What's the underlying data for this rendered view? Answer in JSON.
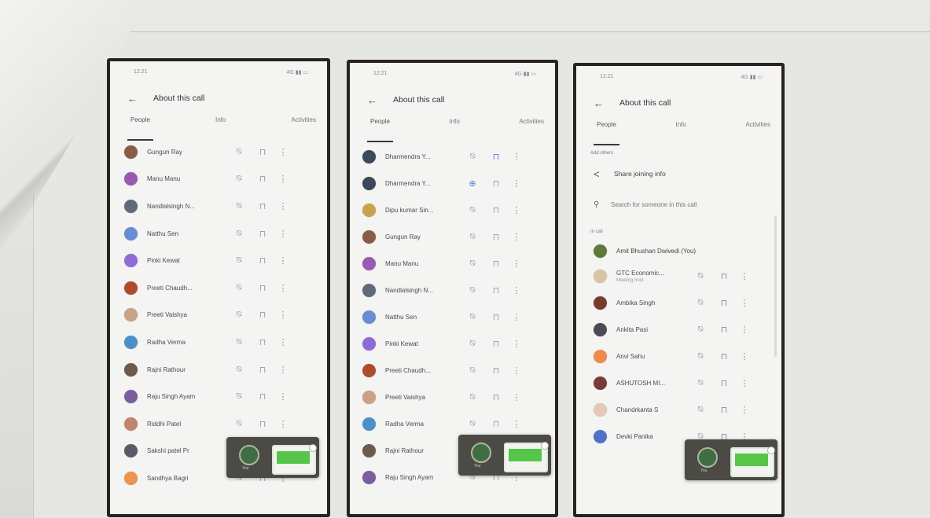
{
  "screen": {
    "title": "About this call",
    "tabs": [
      "People",
      "Info",
      "Activities"
    ],
    "status_time": "12:21",
    "status_right": "4G ▮▮ ▭"
  },
  "icons": {
    "back": "arrow-left-icon",
    "mic_off": "mic-off-icon",
    "pin": "pin-icon",
    "more": "more-vert-icon",
    "share": "share-icon",
    "search": "search-icon",
    "add_person": "add-person-icon"
  },
  "phone1": {
    "people": [
      {
        "name": "Gungun Ray",
        "color": "#8a5b48"
      },
      {
        "name": "Manu Manu",
        "color": "#9b59b6"
      },
      {
        "name": "Nandlalsingh N...",
        "color": "#616a7a"
      },
      {
        "name": "Natthu Sen",
        "color": "#6b8bd6"
      },
      {
        "name": "Pinki Kewat",
        "color": "#8e6bd6"
      },
      {
        "name": "Preeti Chaudh...",
        "color": "#b04a2c"
      },
      {
        "name": "Preeti Vaishya",
        "color": "#c9a187"
      },
      {
        "name": "Radha Verma",
        "color": "#4a90c8"
      },
      {
        "name": "Rajni Rathour",
        "color": "#6d5a4c"
      },
      {
        "name": "Raju Singh Ayam",
        "color": "#7b5ea0"
      },
      {
        "name": "Riddhi Patel",
        "color": "#c0846c"
      },
      {
        "name": "Sakshi patel Pr",
        "color": "#5a5a66"
      },
      {
        "name": "Sandhya Bagri",
        "color": "#f0934e"
      }
    ]
  },
  "phone2": {
    "people": [
      {
        "name": "Dharmendra Y...",
        "color": "#3a4a5a",
        "blue": false,
        "pin_blue": true
      },
      {
        "name": "Dharmendra Y...",
        "color": "#3a4a5a",
        "blue": true,
        "pin_blue": false
      },
      {
        "name": "Dipu kumar Sin...",
        "color": "#c8a34a",
        "blue": false,
        "pin_blue": false
      },
      {
        "name": "Gungun Ray",
        "color": "#8a5b48",
        "blue": false,
        "pin_blue": false
      },
      {
        "name": "Manu Manu",
        "color": "#9b59b6",
        "blue": false,
        "pin_blue": false
      },
      {
        "name": "Nandlalsingh N...",
        "color": "#616a7a",
        "blue": false,
        "pin_blue": false
      },
      {
        "name": "Natthu Sen",
        "color": "#6b8bd6",
        "blue": false,
        "pin_blue": false
      },
      {
        "name": "Pinki Kewat",
        "color": "#8e6bd6",
        "blue": false,
        "pin_blue": false
      },
      {
        "name": "Preeti Chaudh...",
        "color": "#b04a2c",
        "blue": false,
        "pin_blue": false
      },
      {
        "name": "Preeti Vaishya",
        "color": "#c9a187",
        "blue": false,
        "pin_blue": false
      },
      {
        "name": "Radha Verma",
        "color": "#4a90c8",
        "blue": false,
        "pin_blue": false
      },
      {
        "name": "Rajni Rathour",
        "color": "#6d5a4c",
        "blue": false,
        "pin_blue": false
      },
      {
        "name": "Raju Singh Ayam",
        "color": "#7b5ea0",
        "blue": false,
        "pin_blue": false
      }
    ]
  },
  "phone3": {
    "add_others_label": "Add others",
    "share_label": "Share joining info",
    "search_placeholder": "Search for someone in this call",
    "in_call_label": "In call",
    "self": {
      "name": "Amit Bhushan Dwivedi (You)",
      "color": "#5e7a3a"
    },
    "people": [
      {
        "name": "GTC Economic...",
        "sub": "Meeting host",
        "color": "#d8c3a6"
      },
      {
        "name": "Ambika Singh",
        "sub": "",
        "color": "#7a3a2a"
      },
      {
        "name": "Ankita Pasi",
        "sub": "",
        "color": "#4b4b55"
      },
      {
        "name": "Anvi Sahu",
        "sub": "",
        "color": "#f08a4b"
      },
      {
        "name": "ASHUTOSH MI...",
        "sub": "",
        "color": "#7a3a3a"
      },
      {
        "name": "Chandrkanta S",
        "sub": "",
        "color": "#e5c8b8"
      },
      {
        "name": "Devki Panika",
        "sub": "",
        "color": "#4f72c8"
      }
    ]
  },
  "floating_tile": {
    "label": "You"
  }
}
